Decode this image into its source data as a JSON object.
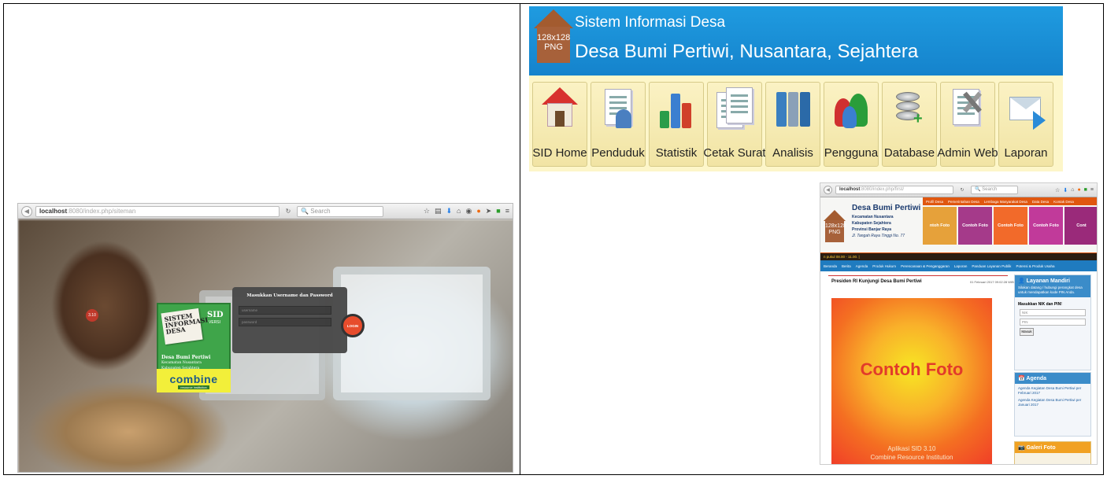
{
  "left": {
    "browser": {
      "url_host": "localhost",
      "url_path": ":8080/index.php/siteman",
      "search_placeholder": "Search"
    },
    "sid": {
      "note_text": "SISTEM INFORMASI DESA",
      "brand": "SID",
      "brand_sub": "VERSI",
      "version": "3.10",
      "village": "Desa Bumi Pertiwi",
      "district": "Kecamatan Nusantara",
      "regency": "Kabupaten Sejahtera"
    },
    "combine": {
      "word": "combine",
      "tagline": "resource institution"
    },
    "login": {
      "title": "Masukkan Username dan Password",
      "username_placeholder": "username",
      "password_placeholder": "password",
      "button": "LOGIN"
    }
  },
  "admin": {
    "logo_text": "128x128 PNG",
    "title": "Sistem Informasi Desa",
    "subtitle": "Desa Bumi Pertiwi, Nusantara, Sejahtera",
    "nav": [
      {
        "label": "SID Home",
        "icon": "home-icon"
      },
      {
        "label": "Penduduk",
        "icon": "resident-document-icon"
      },
      {
        "label": "Statistik",
        "icon": "chart-bars-icon"
      },
      {
        "label": "Cetak Surat",
        "icon": "print-letter-icon"
      },
      {
        "label": "Analisis",
        "icon": "binders-icon"
      },
      {
        "label": "Pengguna",
        "icon": "users-icon"
      },
      {
        "label": "Database",
        "icon": "database-icon"
      },
      {
        "label": "Admin Web",
        "icon": "web-admin-icon"
      },
      {
        "label": "Laporan",
        "icon": "mail-report-icon"
      }
    ]
  },
  "public": {
    "browser": {
      "url_host": "localhost",
      "url_path": ":8080/index.php/first/",
      "search_placeholder": "Search"
    },
    "logo_text": "128x128 PNG",
    "site_name": "Desa Bumi Pertiwi",
    "district": "Kecamatan Nusantara",
    "regency": "Kabupaten Sejahtera",
    "province": "Provinsi Banjar Raya",
    "address": "Jl. Tangah Raya Tinggi No. 77",
    "topnav": [
      "Profil Desa",
      "Pemerintahan Desa",
      "Lembaga Masyarakat Desa",
      "Data Desa",
      "Kontak Desa"
    ],
    "tiles": [
      {
        "label": "ntoh Foto",
        "color": "#e6a13a"
      },
      {
        "label": "Contoh Foto",
        "color": "#a53a8a"
      },
      {
        "label": "Contoh Foto",
        "color": "#f26a2a"
      },
      {
        "label": "Contoh Foto",
        "color": "#c13a9a"
      },
      {
        "label": "Cont",
        "color": "#9a2a7a"
      }
    ],
    "ticker": "n pukul 08.00 - 11.00. |",
    "mainnav": [
      "Beranda",
      "Berita",
      "Agenda",
      "Produk Hukum",
      "Perencanaan & Penganggaran",
      "Laporan",
      "Panduan Layanan Publik",
      "Potensi & Produk Usaha"
    ],
    "post": {
      "title": "Presiden RI Kunjungi Desa Bumi Pertiwi",
      "date": "01 Februari 2017 09:02:28 WIB"
    },
    "photo": {
      "main_text": "Contoh Foto",
      "caption_1": "Aplikasi SID 3.10",
      "caption_2": "Combine Resource Institution"
    },
    "layanan": {
      "title": "Layanan Mandiri",
      "subtitle": "Silakan datang / hubungi perangkat desa untuk mendapatkan kode PIN Anda.",
      "prompt": "Masukkan NIK dan PIN!",
      "nik_placeholder": "NIK",
      "pin_placeholder": "PIN",
      "button": "Masuk"
    },
    "agenda": {
      "title": "Agenda",
      "items": [
        "Agenda Kegiatan Desa Bumi Pertiwi per Februari 2017",
        "Agenda Kegiatan Desa Bumi Pertiwi per Januari 2017"
      ]
    },
    "galeri": {
      "title": "Galeri Foto"
    }
  }
}
